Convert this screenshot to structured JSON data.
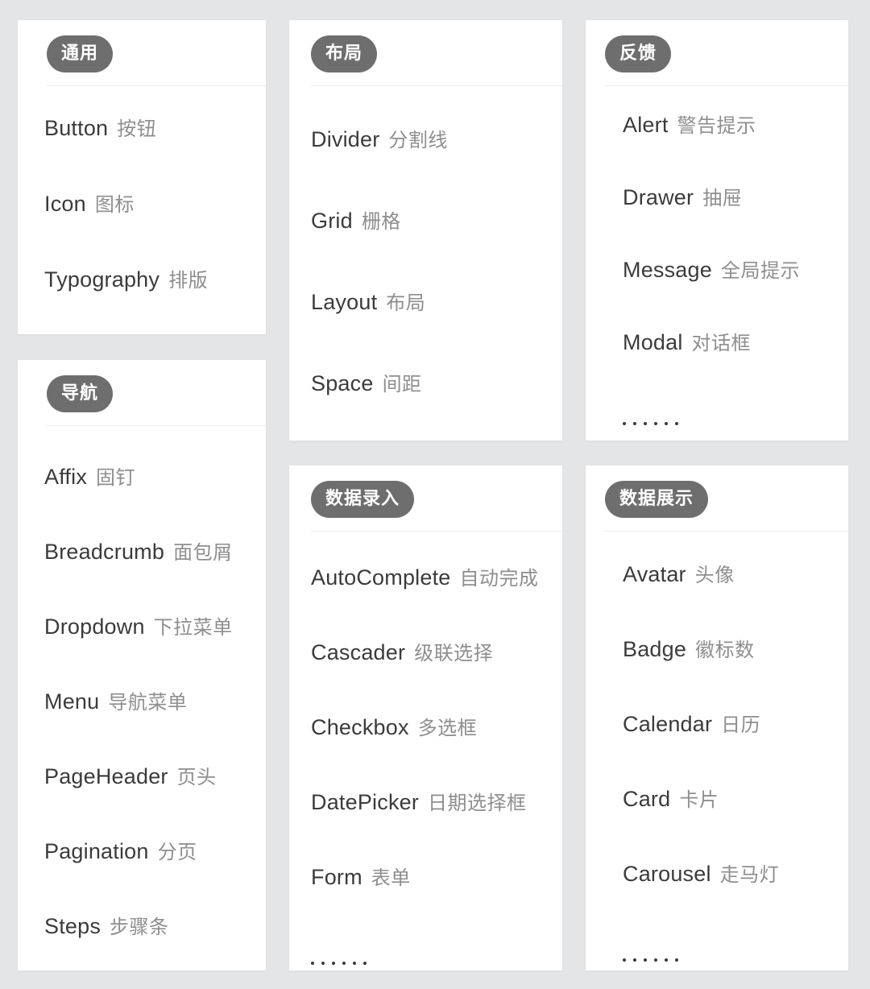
{
  "theme": {
    "page_background": "#e4e5e6",
    "card_background": "#ffffff",
    "pill_background": "#6e6e6e",
    "pill_text": "#ffffff",
    "item_en_color": "#3b3b3b",
    "item_zh_color": "#8e8e8e",
    "divider_color": "#eceded"
  },
  "ellipsis": "……",
  "cards": {
    "general": {
      "title": "通用",
      "items": [
        {
          "en": "Button",
          "zh": "按钮"
        },
        {
          "en": "Icon",
          "zh": "图标"
        },
        {
          "en": "Typography",
          "zh": "排版"
        }
      ]
    },
    "navigation": {
      "title": "导航",
      "items": [
        {
          "en": "Affix",
          "zh": "固钉"
        },
        {
          "en": "Breadcrumb",
          "zh": "面包屑"
        },
        {
          "en": "Dropdown",
          "zh": "下拉菜单"
        },
        {
          "en": "Menu",
          "zh": "导航菜单"
        },
        {
          "en": "PageHeader",
          "zh": "页头"
        },
        {
          "en": "Pagination",
          "zh": "分页"
        },
        {
          "en": "Steps",
          "zh": "步骤条"
        }
      ]
    },
    "layout": {
      "title": "布局",
      "items": [
        {
          "en": "Divider",
          "zh": "分割线"
        },
        {
          "en": "Grid",
          "zh": "栅格"
        },
        {
          "en": "Layout",
          "zh": "布局"
        },
        {
          "en": "Space",
          "zh": "间距"
        }
      ]
    },
    "data_entry": {
      "title": "数据录入",
      "items": [
        {
          "en": "AutoComplete",
          "zh": "自动完成"
        },
        {
          "en": "Cascader",
          "zh": "级联选择"
        },
        {
          "en": "Checkbox",
          "zh": "多选框"
        },
        {
          "en": "DatePicker",
          "zh": "日期选择框"
        },
        {
          "en": "Form",
          "zh": "表单"
        }
      ],
      "has_more": true
    },
    "feedback": {
      "title": "反馈",
      "items": [
        {
          "en": "Alert",
          "zh": "警告提示"
        },
        {
          "en": "Drawer",
          "zh": "抽屉"
        },
        {
          "en": "Message",
          "zh": "全局提示"
        },
        {
          "en": "Modal",
          "zh": "对话框"
        }
      ],
      "has_more": true
    },
    "data_display": {
      "title": "数据展示",
      "items": [
        {
          "en": "Avatar",
          "zh": "头像"
        },
        {
          "en": "Badge",
          "zh": "徽标数"
        },
        {
          "en": "Calendar",
          "zh": "日历"
        },
        {
          "en": "Card",
          "zh": "卡片"
        },
        {
          "en": "Carousel",
          "zh": "走马灯"
        }
      ],
      "has_more": true
    }
  }
}
